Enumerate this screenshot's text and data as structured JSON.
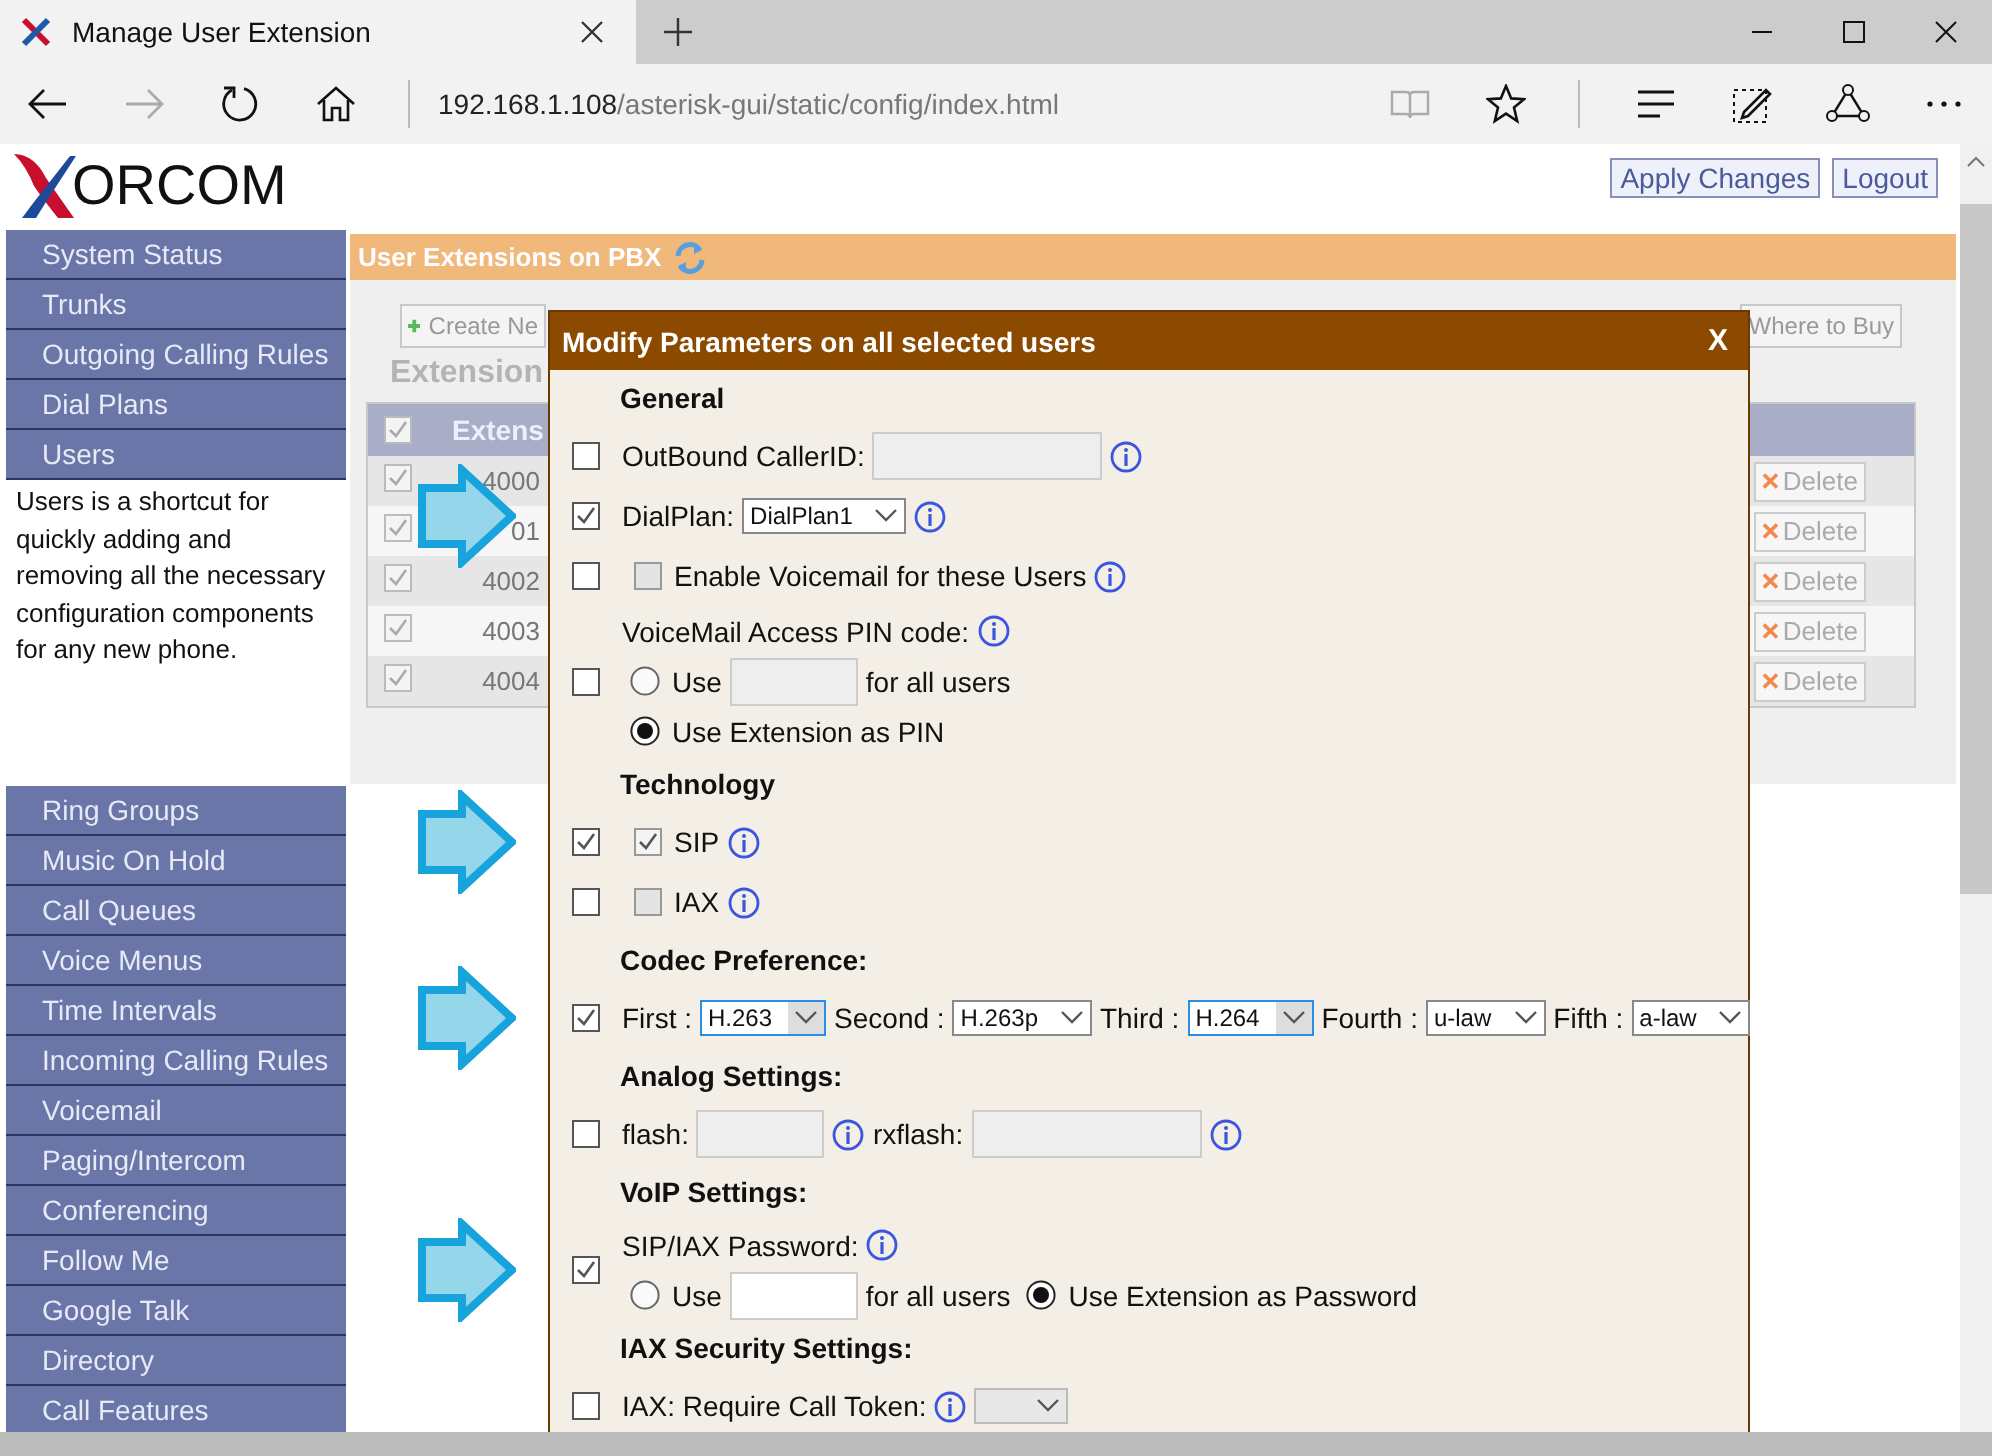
{
  "browser": {
    "tab_title": "Manage User Extension",
    "url": {
      "host": "192.168.1.108",
      "path": "/asterisk-gui/static/config/index.html"
    }
  },
  "header": {
    "logo_text": "ORCOM",
    "buttons": [
      "Apply Changes",
      "Logout"
    ]
  },
  "sidebar": {
    "items": [
      {
        "kind": "link",
        "label": "System Status"
      },
      {
        "kind": "link",
        "label": "Trunks"
      },
      {
        "kind": "link",
        "label": "Outgoing Calling Rules"
      },
      {
        "kind": "link",
        "label": "Dial Plans"
      },
      {
        "kind": "link",
        "label": "Users"
      },
      {
        "kind": "help",
        "label": "Users is a shortcut for quickly adding and removing all the necessary configuration components for any new phone."
      },
      {
        "kind": "link",
        "label": "Ring Groups"
      },
      {
        "kind": "link",
        "label": "Music On Hold"
      },
      {
        "kind": "link",
        "label": "Call Queues"
      },
      {
        "kind": "link",
        "label": "Voice Menus"
      },
      {
        "kind": "link",
        "label": "Time Intervals"
      },
      {
        "kind": "link",
        "label": "Incoming Calling Rules"
      },
      {
        "kind": "link",
        "label": "Voicemail"
      },
      {
        "kind": "link",
        "label": "Paging/Intercom"
      },
      {
        "kind": "link",
        "label": "Conferencing"
      },
      {
        "kind": "link",
        "label": "Follow Me"
      },
      {
        "kind": "link",
        "label": "Google Talk"
      },
      {
        "kind": "link",
        "label": "Directory"
      },
      {
        "kind": "link",
        "label": "Call Features"
      }
    ]
  },
  "main": {
    "title": "User Extensions on PBX",
    "create_button": "Create Ne",
    "buy_button": "Where to Buy",
    "heading": "Extension"
  },
  "table": {
    "header_checked": true,
    "column_1": "Extens",
    "rows": [
      {
        "checked": true,
        "extension": "4000",
        "action": "Delete"
      },
      {
        "checked": true,
        "extension": "01",
        "action": "Delete"
      },
      {
        "checked": true,
        "extension": "4002",
        "action": "Delete"
      },
      {
        "checked": true,
        "extension": "4003",
        "action": "Delete"
      },
      {
        "checked": true,
        "extension": "4004",
        "action": "Delete"
      }
    ]
  },
  "modal": {
    "title": "Modify Parameters on all selected users",
    "close": "X",
    "sections": [
      {
        "heading": "General",
        "rows": [
          {
            "checked": false,
            "arrow": false,
            "lines": [
              [
                {
                  "kind": "label",
                  "text": "OutBound CallerID:"
                },
                {
                  "kind": "field",
                  "disabled": true
                },
                {
                  "kind": "info"
                }
              ]
            ]
          },
          {
            "checked": true,
            "arrow": true,
            "lines": [
              [
                {
                  "kind": "label",
                  "text": "DialPlan:"
                },
                {
                  "kind": "select",
                  "value": "DialPlan1",
                  "highlighted": false,
                  "disabled": false
                },
                {
                  "kind": "info"
                }
              ]
            ]
          },
          {
            "checked": false,
            "arrow": false,
            "lines": [
              [
                {
                  "kind": "checkbox",
                  "checked": false,
                  "text": "Enable Voicemail for these Users"
                },
                {
                  "kind": "info"
                }
              ]
            ]
          },
          {
            "checked": false,
            "arrow": false,
            "lines": [
              [
                {
                  "kind": "label",
                  "text": "VoiceMail Access PIN code:"
                },
                {
                  "kind": "info"
                }
              ],
              [
                {
                  "kind": "radio",
                  "selected": false,
                  "text": "Use"
                },
                {
                  "kind": "field",
                  "disabled": true
                },
                {
                  "kind": "label",
                  "text": "for all users"
                }
              ],
              [
                {
                  "kind": "radio",
                  "selected": true,
                  "text": "Use Extension as PIN"
                }
              ]
            ]
          }
        ]
      },
      {
        "heading": "Technology",
        "rows": [
          {
            "checked": true,
            "arrow": true,
            "lines": [
              [
                {
                  "kind": "checkbox",
                  "checked": true,
                  "text": "SIP"
                },
                {
                  "kind": "info"
                }
              ]
            ]
          },
          {
            "checked": false,
            "arrow": false,
            "lines": [
              [
                {
                  "kind": "checkbox",
                  "checked": false,
                  "text": "IAX"
                },
                {
                  "kind": "info"
                }
              ]
            ]
          }
        ]
      },
      {
        "heading": "Codec Preference:",
        "rows": [
          {
            "checked": true,
            "arrow": true,
            "lines": [
              [
                {
                  "kind": "label",
                  "text": "First :"
                },
                {
                  "kind": "select",
                  "value": "H.263",
                  "highlighted": true,
                  "disabled": false
                },
                {
                  "kind": "label",
                  "text": "Second :"
                },
                {
                  "kind": "select",
                  "value": "H.263p",
                  "highlighted": false,
                  "disabled": false
                },
                {
                  "kind": "label",
                  "text": "Third :"
                },
                {
                  "kind": "select",
                  "value": "H.264",
                  "highlighted": true,
                  "disabled": false
                },
                {
                  "kind": "label",
                  "text": "Fourth :"
                },
                {
                  "kind": "select",
                  "value": "u-law",
                  "highlighted": false,
                  "disabled": false
                },
                {
                  "kind": "label",
                  "text": "Fifth :"
                },
                {
                  "kind": "select",
                  "value": "a-law",
                  "highlighted": false,
                  "disabled": false
                }
              ]
            ]
          }
        ]
      },
      {
        "heading": "Analog Settings:",
        "rows": [
          {
            "checked": false,
            "arrow": false,
            "lines": [
              [
                {
                  "kind": "label",
                  "text": "flash:"
                },
                {
                  "kind": "field",
                  "disabled": true
                },
                {
                  "kind": "info"
                },
                {
                  "kind": "label",
                  "text": "rxflash:"
                },
                {
                  "kind": "field",
                  "disabled": true
                },
                {
                  "kind": "info"
                }
              ]
            ]
          }
        ]
      },
      {
        "heading": "VoIP Settings:",
        "rows": [
          {
            "checked": true,
            "arrow": true,
            "lines": [
              [
                {
                  "kind": "label",
                  "text": "SIP/IAX Password:"
                },
                {
                  "kind": "info"
                }
              ],
              [
                {
                  "kind": "radio",
                  "selected": false,
                  "text": "Use"
                },
                {
                  "kind": "field",
                  "disabled": false
                },
                {
                  "kind": "label",
                  "text": "for all users"
                },
                {
                  "kind": "radio",
                  "selected": true,
                  "text": "Use Extension as Password"
                }
              ]
            ]
          }
        ]
      },
      {
        "heading": "IAX Security Settings:",
        "rows": [
          {
            "checked": false,
            "arrow": false,
            "lines": [
              [
                {
                  "kind": "label",
                  "text": "IAX: Require Call Token:"
                },
                {
                  "kind": "info"
                },
                {
                  "kind": "select",
                  "disabled": true
                }
              ]
            ]
          }
        ]
      }
    ]
  }
}
